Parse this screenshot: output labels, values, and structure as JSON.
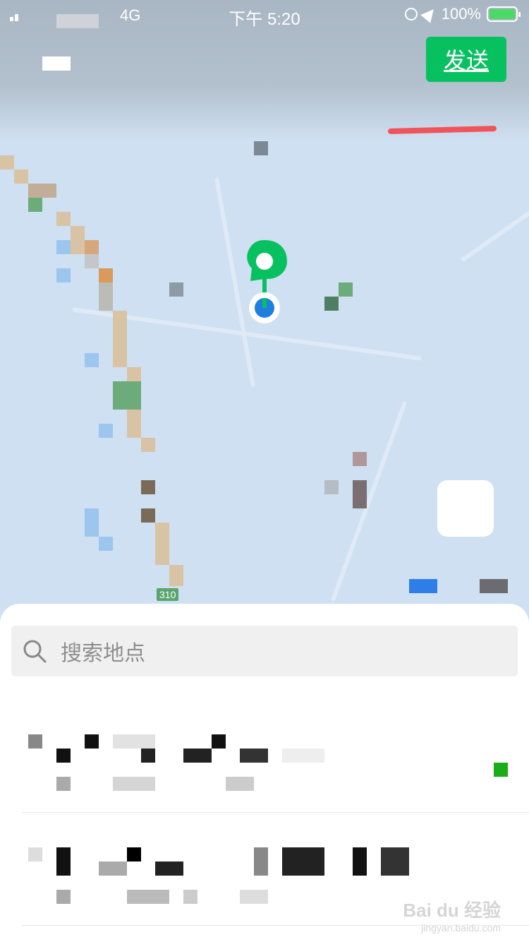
{
  "status_bar": {
    "network": "4G",
    "time": "下午 5:20",
    "battery_percent": "100%",
    "icons": [
      "signal-icon",
      "orientation-lock-icon",
      "location-arrow-icon",
      "battery-charging-icon"
    ]
  },
  "header": {
    "send_label": "发送"
  },
  "map": {
    "road_label": "310"
  },
  "search": {
    "placeholder": "搜索地点"
  },
  "results": [
    {
      "selected": true
    },
    {
      "selected": false
    }
  ],
  "watermark": {
    "brand": "Bai du 经验",
    "url": "jingyan.baidu.com"
  },
  "colors": {
    "accent": "#07c160",
    "pin": "#07c160",
    "location_dot": "#1f7fe0",
    "annotation": "#f0545b",
    "map_background": "#cfe0f2"
  }
}
